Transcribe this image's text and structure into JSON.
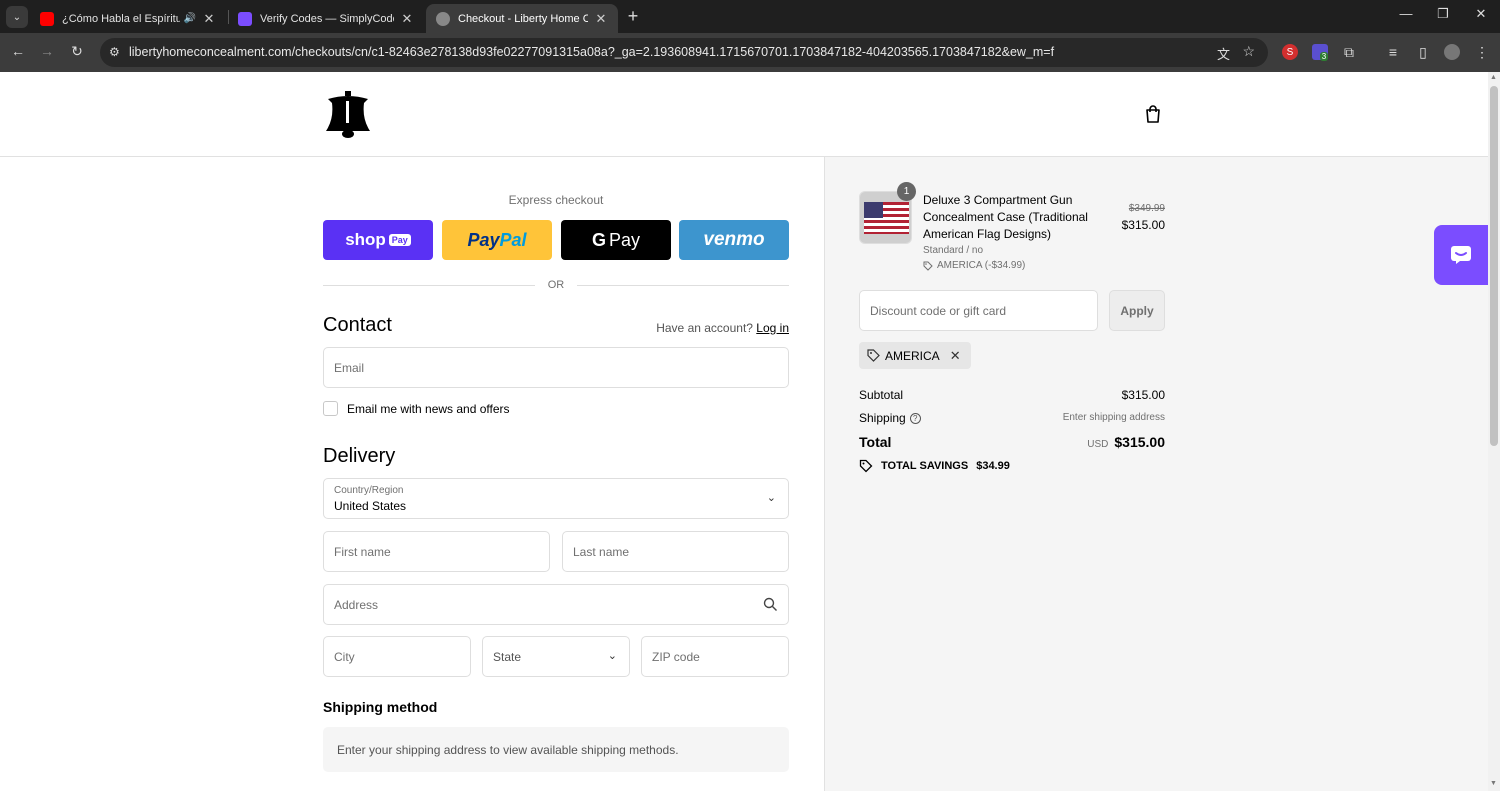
{
  "browser": {
    "tabs": [
      {
        "title": "¿Cómo Habla el Espíritu Sa",
        "favicon_color": "#ff0000"
      },
      {
        "title": "Verify Codes — SimplyCodes",
        "favicon_color": "#7b4dff"
      },
      {
        "title": "Checkout - Liberty Home Conc",
        "favicon_color": "#888888"
      }
    ],
    "url": "libertyhomeconcealment.com/checkouts/cn/c1-82463e278138d93fe02277091315a08a?_ga=2.193608941.1715670701.1703847182-404203565.1703847182&ew_m=f",
    "extension_badge": "3"
  },
  "checkout": {
    "express_title": "Express checkout",
    "shop_pay": {
      "label": "shop",
      "badge": "Pay"
    },
    "paypal": {
      "part1": "Pay",
      "part2": "Pal"
    },
    "gpay": {
      "g": "G",
      "label": "Pay"
    },
    "venmo": "venmo",
    "or_text": "OR",
    "contact": {
      "title": "Contact",
      "have_account": "Have an account?",
      "login": "Log in",
      "email_placeholder": "Email",
      "news_label": "Email me with news and offers"
    },
    "delivery": {
      "title": "Delivery",
      "country_label": "Country/Region",
      "country_value": "United States",
      "first_name": "First name",
      "last_name": "Last name",
      "address": "Address",
      "city": "City",
      "state": "State",
      "zip": "ZIP code"
    },
    "shipping": {
      "title": "Shipping method",
      "message": "Enter your shipping address to view available shipping methods."
    }
  },
  "summary": {
    "item": {
      "qty": "1",
      "name": "Deluxe 3 Compartment Gun Concealment Case (Traditional American Flag Designs)",
      "variant": "Standard / no",
      "discount": "AMERICA (-$34.99)",
      "original_price": "$349.99",
      "price": "$315.00"
    },
    "discount_placeholder": "Discount code or gift card",
    "apply": "Apply",
    "applied_code": "AMERICA",
    "subtotal_label": "Subtotal",
    "subtotal": "$315.00",
    "shipping_label": "Shipping",
    "shipping_value": "Enter shipping address",
    "total_label": "Total",
    "currency": "USD",
    "total": "$315.00",
    "savings_label": "TOTAL SAVINGS",
    "savings": "$34.99"
  },
  "colors": {
    "shop_pay": "#5a31f4",
    "paypal": "#ffc439",
    "gpay": "#000000",
    "venmo": "#3d95ce",
    "chat_widget": "#7b4dff"
  }
}
